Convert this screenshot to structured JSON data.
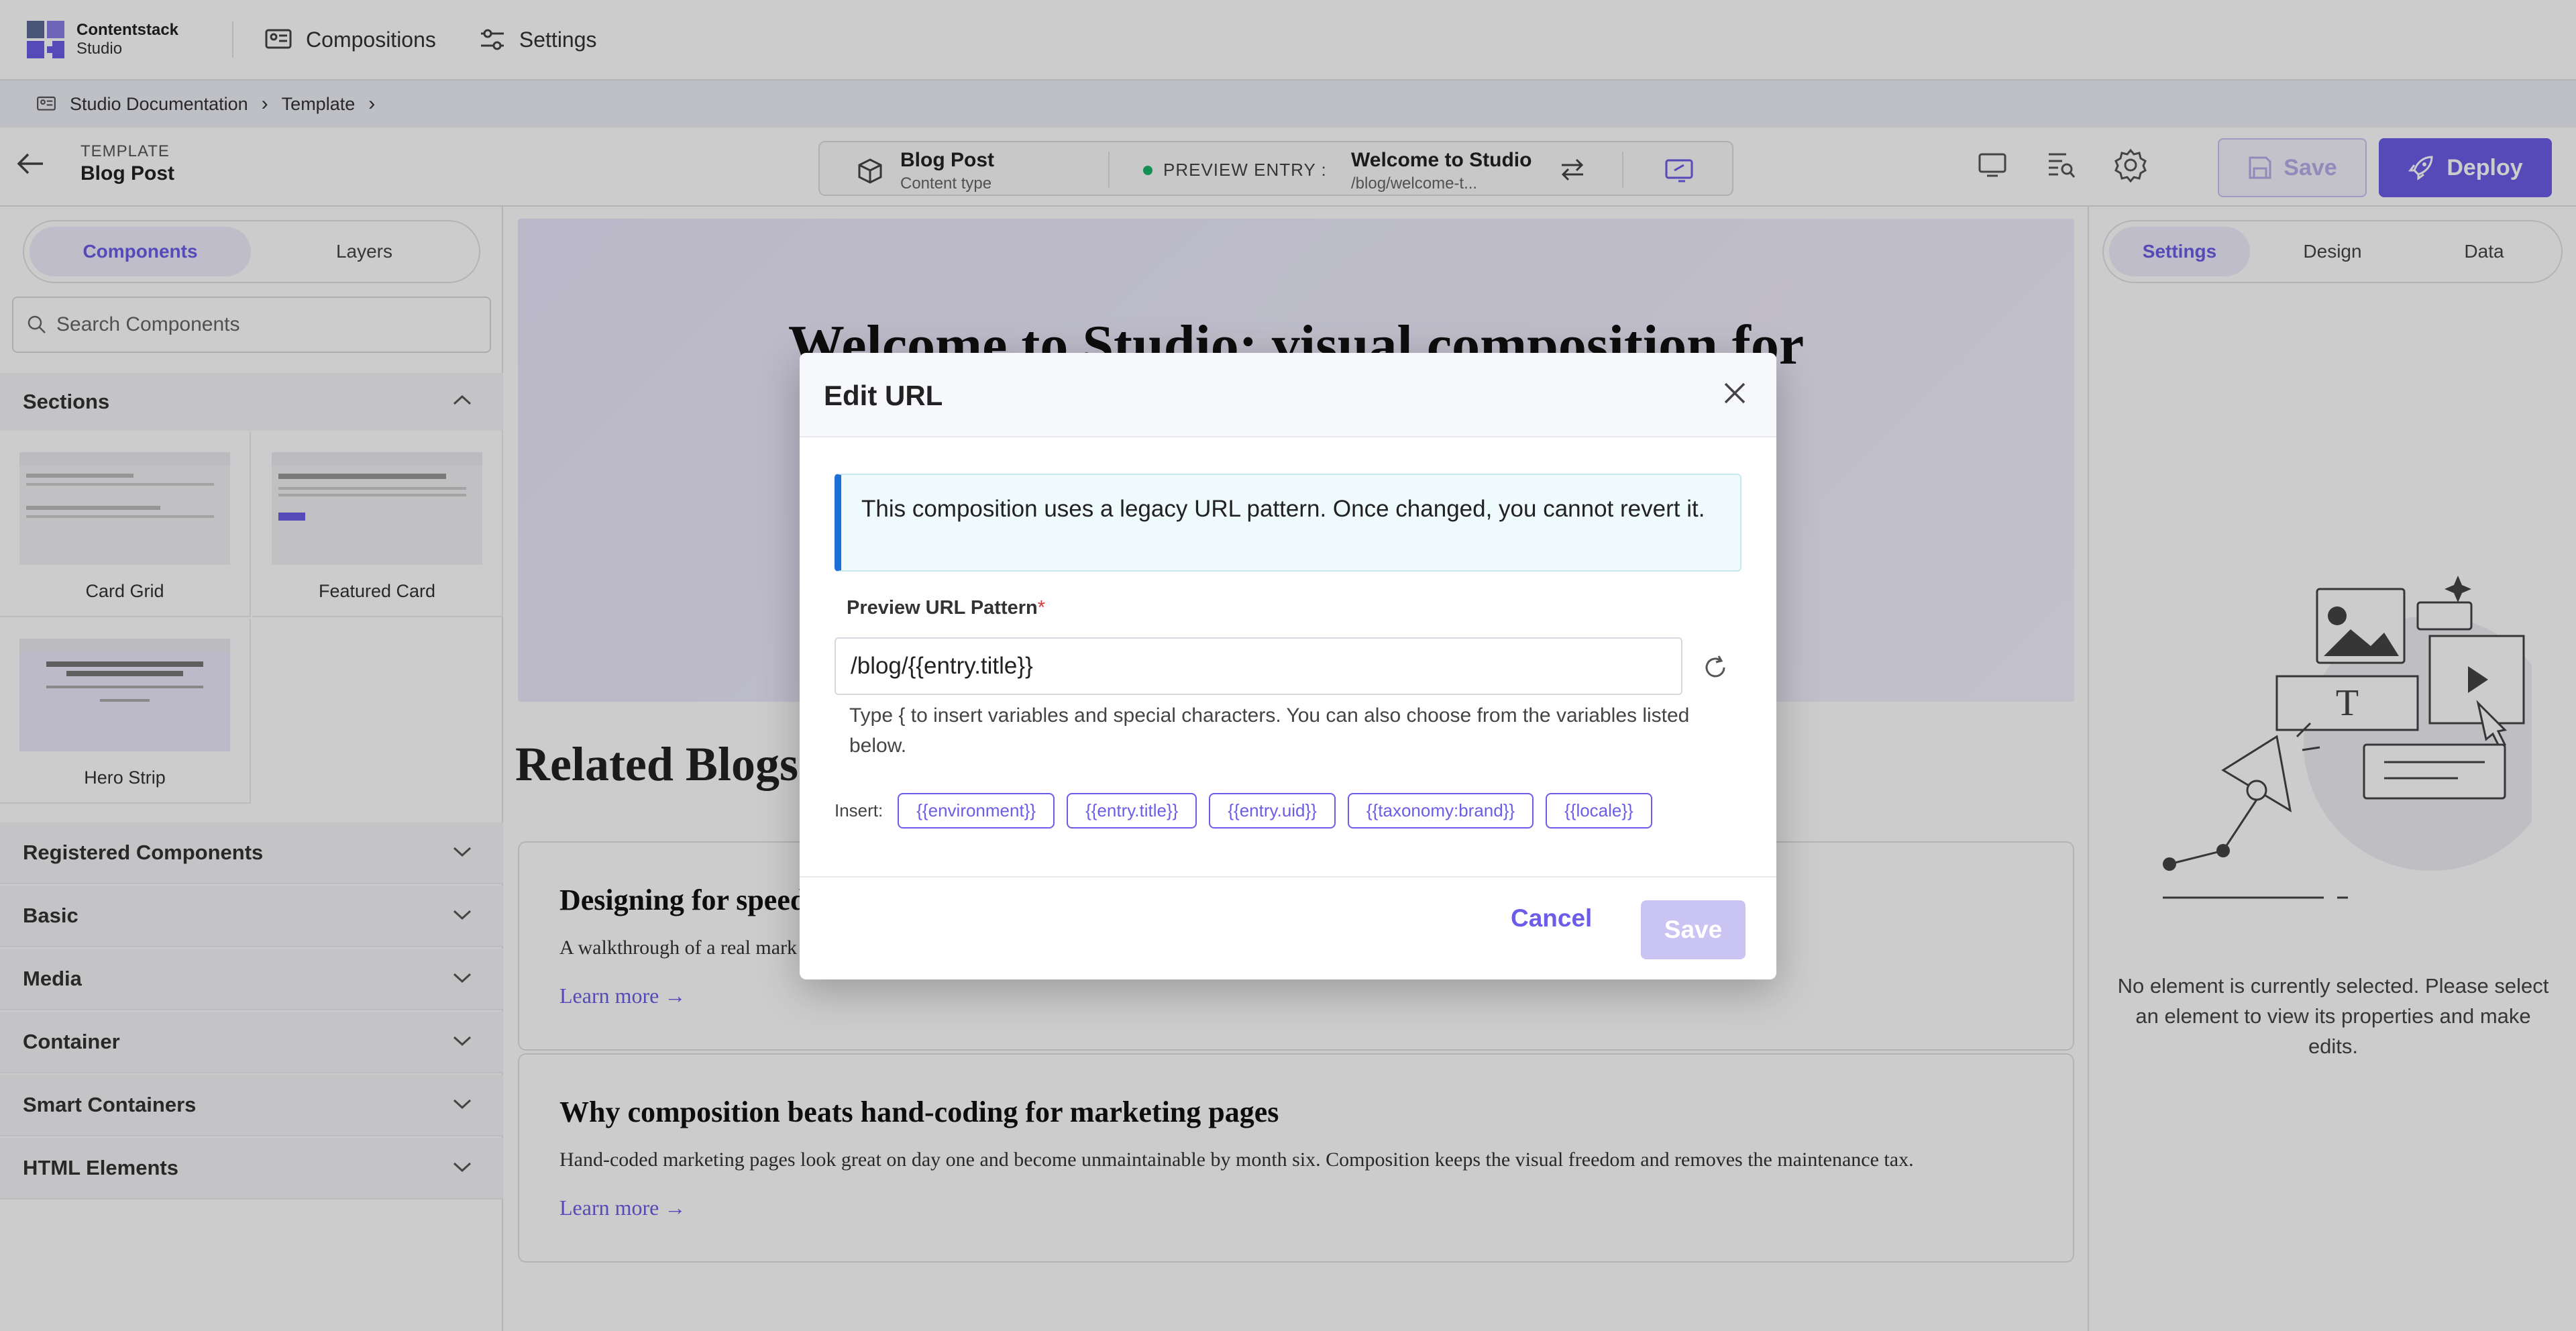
{
  "app": {
    "brand_line1": "Contentstack",
    "brand_line2": "Studio"
  },
  "topnav": {
    "items": [
      {
        "label": "Compositions",
        "icon": "compositions-icon"
      },
      {
        "label": "Settings",
        "icon": "sliders-icon"
      }
    ]
  },
  "breadcrumb": {
    "items": [
      "Studio Documentation",
      "Template"
    ]
  },
  "toolbar": {
    "template_label": "TEMPLATE",
    "template_name": "Blog Post",
    "content_type_title": "Blog Post",
    "content_type_sub": "Content type",
    "preview_label": "PREVIEW ENTRY :",
    "entry_title": "Welcome to Studio",
    "entry_url": "/blog/welcome-t...",
    "save_label": "Save",
    "deploy_label": "Deploy"
  },
  "left": {
    "tabs": [
      "Components",
      "Layers"
    ],
    "search_placeholder": "Search Components",
    "sections_title": "Sections",
    "cards": [
      "Card Grid",
      "Featured Card",
      "Hero Strip"
    ],
    "accordions": [
      "Registered Components",
      "Basic",
      "Media",
      "Container",
      "Smart Containers",
      "HTML Elements"
    ]
  },
  "canvas": {
    "hero_title": "Welcome to Studio: visual composition for",
    "related_title": "Related Blogs",
    "posts": [
      {
        "title": "Designing for speed",
        "desc": "A walkthrough of a real mark",
        "link": "Learn more →"
      },
      {
        "title": "Why composition beats hand-coding for marketing pages",
        "desc": "Hand-coded marketing pages look great on day one and become unmaintainable by month six. Composition keeps the visual freedom and removes the maintenance tax.",
        "link": "Learn more →"
      }
    ]
  },
  "right": {
    "tabs": [
      "Settings",
      "Design",
      "Data"
    ],
    "empty_message": "No element is currently selected. Please select an element to view its properties and make edits."
  },
  "modal": {
    "title": "Edit URL",
    "notice": "This composition uses a legacy URL pattern. Once changed, you cannot revert it.",
    "field_label": "Preview URL Pattern",
    "required_mark": "*",
    "url_value": "/blog/{{entry.title}}",
    "hint": "Type { to insert variables and special characters. You can also choose from the variables listed below.",
    "insert_label": "Insert:",
    "chips": [
      "{{environment}}",
      "{{entry.title}}",
      "{{entry.uid}}",
      "{{taxonomy:brand}}",
      "{{locale}}"
    ],
    "cancel_label": "Cancel",
    "save_label": "Save"
  },
  "colors": {
    "accent": "#6c5ce7",
    "accent_disabled": "#c9c4f2",
    "notice_border": "#1d6fd6",
    "status_green": "#19b36b"
  }
}
